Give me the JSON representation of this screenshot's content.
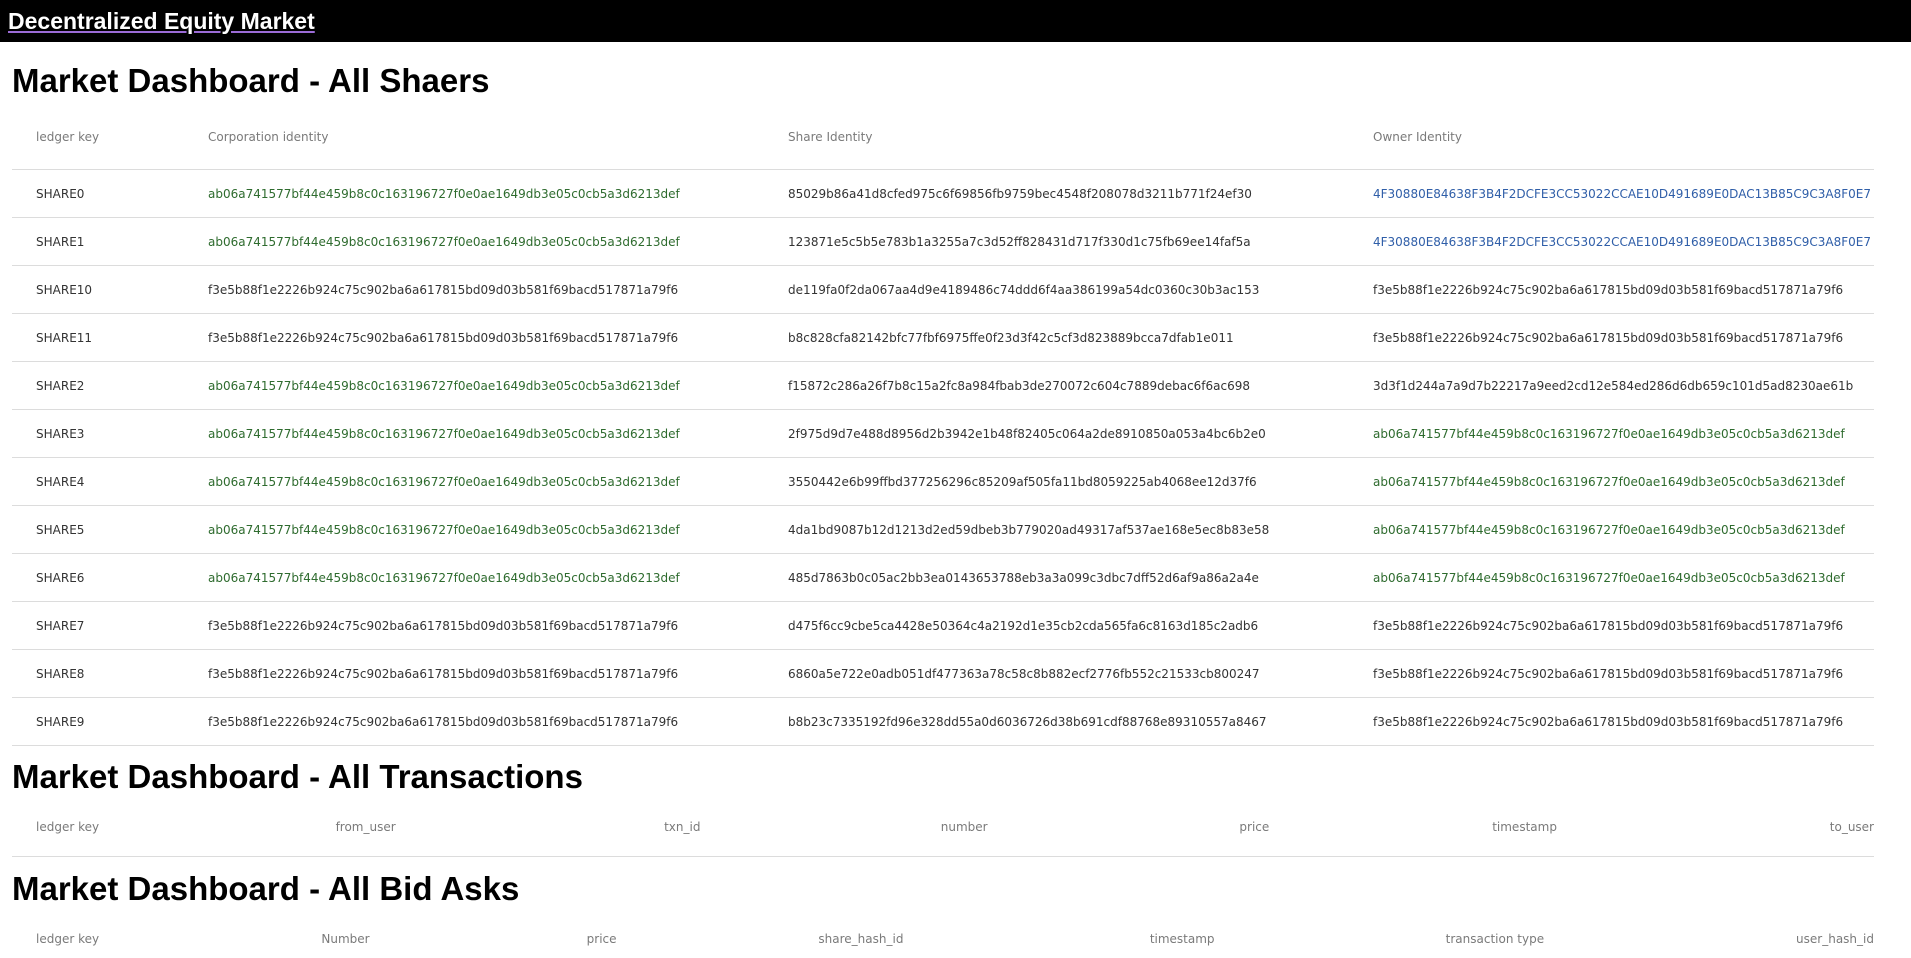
{
  "app": {
    "title": "Decentralized Equity Market"
  },
  "shares_section": {
    "title": "Market Dashboard - All Shaers",
    "columns": [
      "ledger key",
      "Corporation identity",
      "Share Identity",
      "Owner Identity"
    ],
    "rows": [
      {
        "key": "SHARE0",
        "corp": "ab06a741577bf44e459b8c0c163196727f0e0ae1649db3e05c0cb5a3d6213def",
        "corp_color": "green",
        "share": "85029b86a41d8cfed975c6f69856fb9759bec4548f208078d3211b771f24ef30",
        "owner": "4F30880E84638F3B4F2DCFE3CC53022CCAE10D491689E0DAC13B85C9C3A8F0E7",
        "owner_color": "blue"
      },
      {
        "key": "SHARE1",
        "corp": "ab06a741577bf44e459b8c0c163196727f0e0ae1649db3e05c0cb5a3d6213def",
        "corp_color": "green",
        "share": "123871e5c5b5e783b1a3255a7c3d52ff828431d717f330d1c75fb69ee14faf5a",
        "owner": "4F30880E84638F3B4F2DCFE3CC53022CCAE10D491689E0DAC13B85C9C3A8F0E7",
        "owner_color": "blue"
      },
      {
        "key": "SHARE10",
        "corp": "f3e5b88f1e2226b924c75c902ba6a617815bd09d03b581f69bacd517871a79f6",
        "corp_color": "plain",
        "share": "de119fa0f2da067aa4d9e4189486c74ddd6f4aa386199a54dc0360c30b3ac153",
        "owner": "f3e5b88f1e2226b924c75c902ba6a617815bd09d03b581f69bacd517871a79f6",
        "owner_color": "plain"
      },
      {
        "key": "SHARE11",
        "corp": "f3e5b88f1e2226b924c75c902ba6a617815bd09d03b581f69bacd517871a79f6",
        "corp_color": "plain",
        "share": "b8c828cfa82142bfc77fbf6975ffe0f23d3f42c5cf3d823889bcca7dfab1e011",
        "owner": "f3e5b88f1e2226b924c75c902ba6a617815bd09d03b581f69bacd517871a79f6",
        "owner_color": "plain"
      },
      {
        "key": "SHARE2",
        "corp": "ab06a741577bf44e459b8c0c163196727f0e0ae1649db3e05c0cb5a3d6213def",
        "corp_color": "green",
        "share": "f15872c286a26f7b8c15a2fc8a984fbab3de270072c604c7889debac6f6ac698",
        "owner": "3d3f1d244a7a9d7b22217a9eed2cd12e584ed286d6db659c101d5ad8230ae61b",
        "owner_color": "plain"
      },
      {
        "key": "SHARE3",
        "corp": "ab06a741577bf44e459b8c0c163196727f0e0ae1649db3e05c0cb5a3d6213def",
        "corp_color": "green",
        "share": "2f975d9d7e488d8956d2b3942e1b48f82405c064a2de8910850a053a4bc6b2e0",
        "owner": "ab06a741577bf44e459b8c0c163196727f0e0ae1649db3e05c0cb5a3d6213def",
        "owner_color": "green"
      },
      {
        "key": "SHARE4",
        "corp": "ab06a741577bf44e459b8c0c163196727f0e0ae1649db3e05c0cb5a3d6213def",
        "corp_color": "green",
        "share": "3550442e6b99ffbd377256296c85209af505fa11bd8059225ab4068ee12d37f6",
        "owner": "ab06a741577bf44e459b8c0c163196727f0e0ae1649db3e05c0cb5a3d6213def",
        "owner_color": "green"
      },
      {
        "key": "SHARE5",
        "corp": "ab06a741577bf44e459b8c0c163196727f0e0ae1649db3e05c0cb5a3d6213def",
        "corp_color": "green",
        "share": "4da1bd9087b12d1213d2ed59dbeb3b779020ad49317af537ae168e5ec8b83e58",
        "owner": "ab06a741577bf44e459b8c0c163196727f0e0ae1649db3e05c0cb5a3d6213def",
        "owner_color": "green"
      },
      {
        "key": "SHARE6",
        "corp": "ab06a741577bf44e459b8c0c163196727f0e0ae1649db3e05c0cb5a3d6213def",
        "corp_color": "green",
        "share": "485d7863b0c05ac2bb3ea0143653788eb3a3a099c3dbc7dff52d6af9a86a2a4e",
        "owner": "ab06a741577bf44e459b8c0c163196727f0e0ae1649db3e05c0cb5a3d6213def",
        "owner_color": "green"
      },
      {
        "key": "SHARE7",
        "corp": "f3e5b88f1e2226b924c75c902ba6a617815bd09d03b581f69bacd517871a79f6",
        "corp_color": "plain",
        "share": "d475f6cc9cbe5ca4428e50364c4a2192d1e35cb2cda565fa6c8163d185c2adb6",
        "owner": "f3e5b88f1e2226b924c75c902ba6a617815bd09d03b581f69bacd517871a79f6",
        "owner_color": "plain"
      },
      {
        "key": "SHARE8",
        "corp": "f3e5b88f1e2226b924c75c902ba6a617815bd09d03b581f69bacd517871a79f6",
        "corp_color": "plain",
        "share": "6860a5e722e0adb051df477363a78c58c8b882ecf2776fb552c21533cb800247",
        "owner": "f3e5b88f1e2226b924c75c902ba6a617815bd09d03b581f69bacd517871a79f6",
        "owner_color": "plain"
      },
      {
        "key": "SHARE9",
        "corp": "f3e5b88f1e2226b924c75c902ba6a617815bd09d03b581f69bacd517871a79f6",
        "corp_color": "plain",
        "share": "b8b23c7335192fd96e328dd55a0d6036726d38b691cdf88768e89310557a8467",
        "owner": "f3e5b88f1e2226b924c75c902ba6a617815bd09d03b581f69bacd517871a79f6",
        "owner_color": "plain"
      }
    ]
  },
  "transactions_section": {
    "title": "Market Dashboard - All Transactions",
    "columns": [
      "ledger key",
      "from_user",
      "txn_id",
      "number",
      "price",
      "timestamp",
      "to_user"
    ]
  },
  "bidasks_section": {
    "title": "Market Dashboard - All Bid Asks",
    "columns": [
      "ledger key",
      "Number",
      "price",
      "share_hash_id",
      "timestamp",
      "transaction type",
      "user_hash_id"
    ]
  },
  "colors": {
    "green": "#2e6b2e",
    "blue": "#2f5ea8",
    "header_bg": "#000000"
  }
}
